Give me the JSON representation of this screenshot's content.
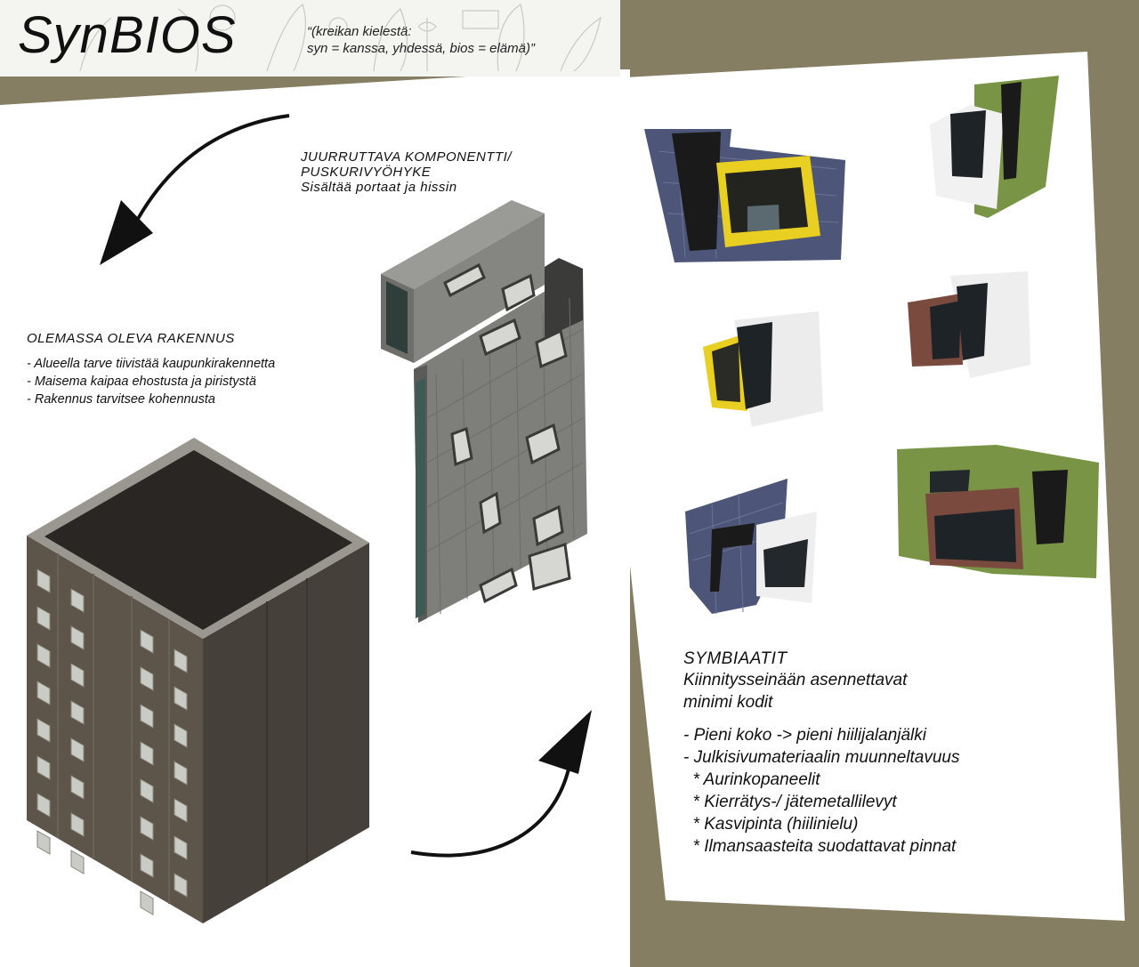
{
  "header": {
    "title": "SynBIOS",
    "etymology_line1": "“(kreikan kielestä:",
    "etymology_line2": "syn = kanssa, yhdessä, bios = elämä)”"
  },
  "component": {
    "heading_line1": "JUURRUTTAVA KOMPONENTTI/",
    "heading_line2": "PUSKURIVYÖHYKE",
    "desc": "Sisältää portaat ja hissin"
  },
  "existing": {
    "heading": "OLEMASSA OLEVA RAKENNUS",
    "items": [
      "- Alueella tarve tiivistää kaupunkirakennetta",
      "- Maisema kaipaa ehostusta  ja piristystä",
      "- Rakennus tarvitsee kohennusta"
    ]
  },
  "symbiaatit": {
    "heading": "SYMBIAATIT",
    "subtitle_line1": "Kiinnitysseinään asennettavat",
    "subtitle_line2": "minimi kodit",
    "items": [
      "- Pieni koko -> pieni hiilijalanjälki",
      "- Julkisivumateriaalin muunneltavuus",
      "  * Aurinkopaneelit",
      "  * Kierrätys-/ jätemetallilevyt",
      "  * Kasvipinta (hiilinielu)",
      "  * Ilmansaasteita suodattavat pinnat"
    ]
  },
  "colors": {
    "background": "#867e63",
    "panel": "#ffffff",
    "brick": "#5a5148",
    "roof": "#2a2623",
    "concrete": "#8c8c89",
    "accent_yellow": "#e8cf22",
    "green_wall": "#7a9446"
  }
}
